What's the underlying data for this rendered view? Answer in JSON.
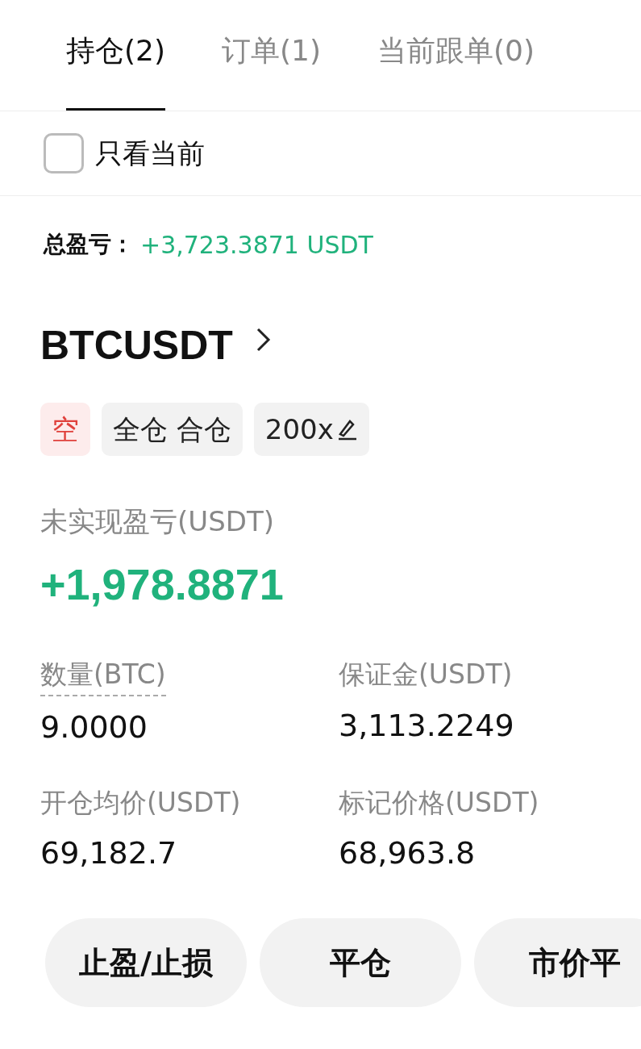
{
  "tabs": [
    {
      "label": "持仓(2)",
      "selected": true
    },
    {
      "label": "订单(1)",
      "selected": false
    },
    {
      "label": "当前跟单(0)",
      "selected": false
    }
  ],
  "filter": {
    "label": "只看当前",
    "checked": false
  },
  "total_pnl": {
    "label": "总盈亏：",
    "value": "+3,723.3871 USDT"
  },
  "position": {
    "symbol": "BTCUSDT",
    "tags": [
      {
        "kind": "side",
        "text": "空"
      },
      {
        "kind": "mode",
        "text": "全仓 合仓"
      },
      {
        "kind": "leverage",
        "text": "200x"
      }
    ],
    "unrealized_label": "未实现盈亏(USDT)",
    "unrealized_value": "+1,978.8871",
    "fields": [
      {
        "label": "数量(BTC)",
        "value": "9.0000",
        "dotted": true
      },
      {
        "label": "保证金(USDT)",
        "value": "3,113.2249",
        "dotted": false
      },
      {
        "label": "开仓均价(USDT)",
        "value": "69,182.7",
        "dotted": false
      },
      {
        "label": "标记价格(USDT)",
        "value": "68,963.8",
        "dotted": false
      }
    ]
  },
  "actions": [
    "止盈/止损",
    "平仓",
    "市价平"
  ]
}
